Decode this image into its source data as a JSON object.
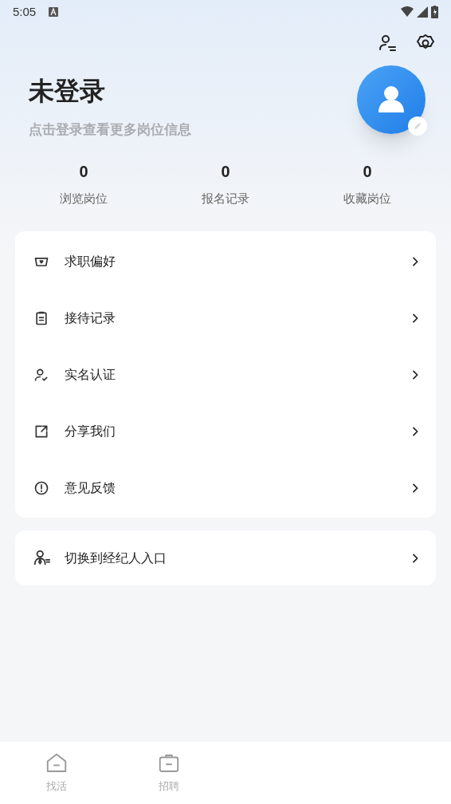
{
  "status_bar": {
    "time": "5:05"
  },
  "profile": {
    "title": "未登录",
    "subtitle": "点击登录查看更多岗位信息"
  },
  "stats": [
    {
      "value": "0",
      "label": "浏览岗位"
    },
    {
      "value": "0",
      "label": "报名记录"
    },
    {
      "value": "0",
      "label": "收藏岗位"
    }
  ],
  "menu": [
    {
      "kind": "preference",
      "label": "求职偏好"
    },
    {
      "kind": "clipboard",
      "label": "接待记录"
    },
    {
      "kind": "verify",
      "label": "实名认证"
    },
    {
      "kind": "share",
      "label": "分享我们"
    },
    {
      "kind": "feedback",
      "label": "意见反馈"
    }
  ],
  "switch_entry": {
    "label": "切换到经纪人入口"
  },
  "bottom_nav": [
    {
      "kind": "home",
      "label": "找活",
      "selected": false
    },
    {
      "kind": "briefcase",
      "label": "招聘",
      "selected": false
    }
  ]
}
